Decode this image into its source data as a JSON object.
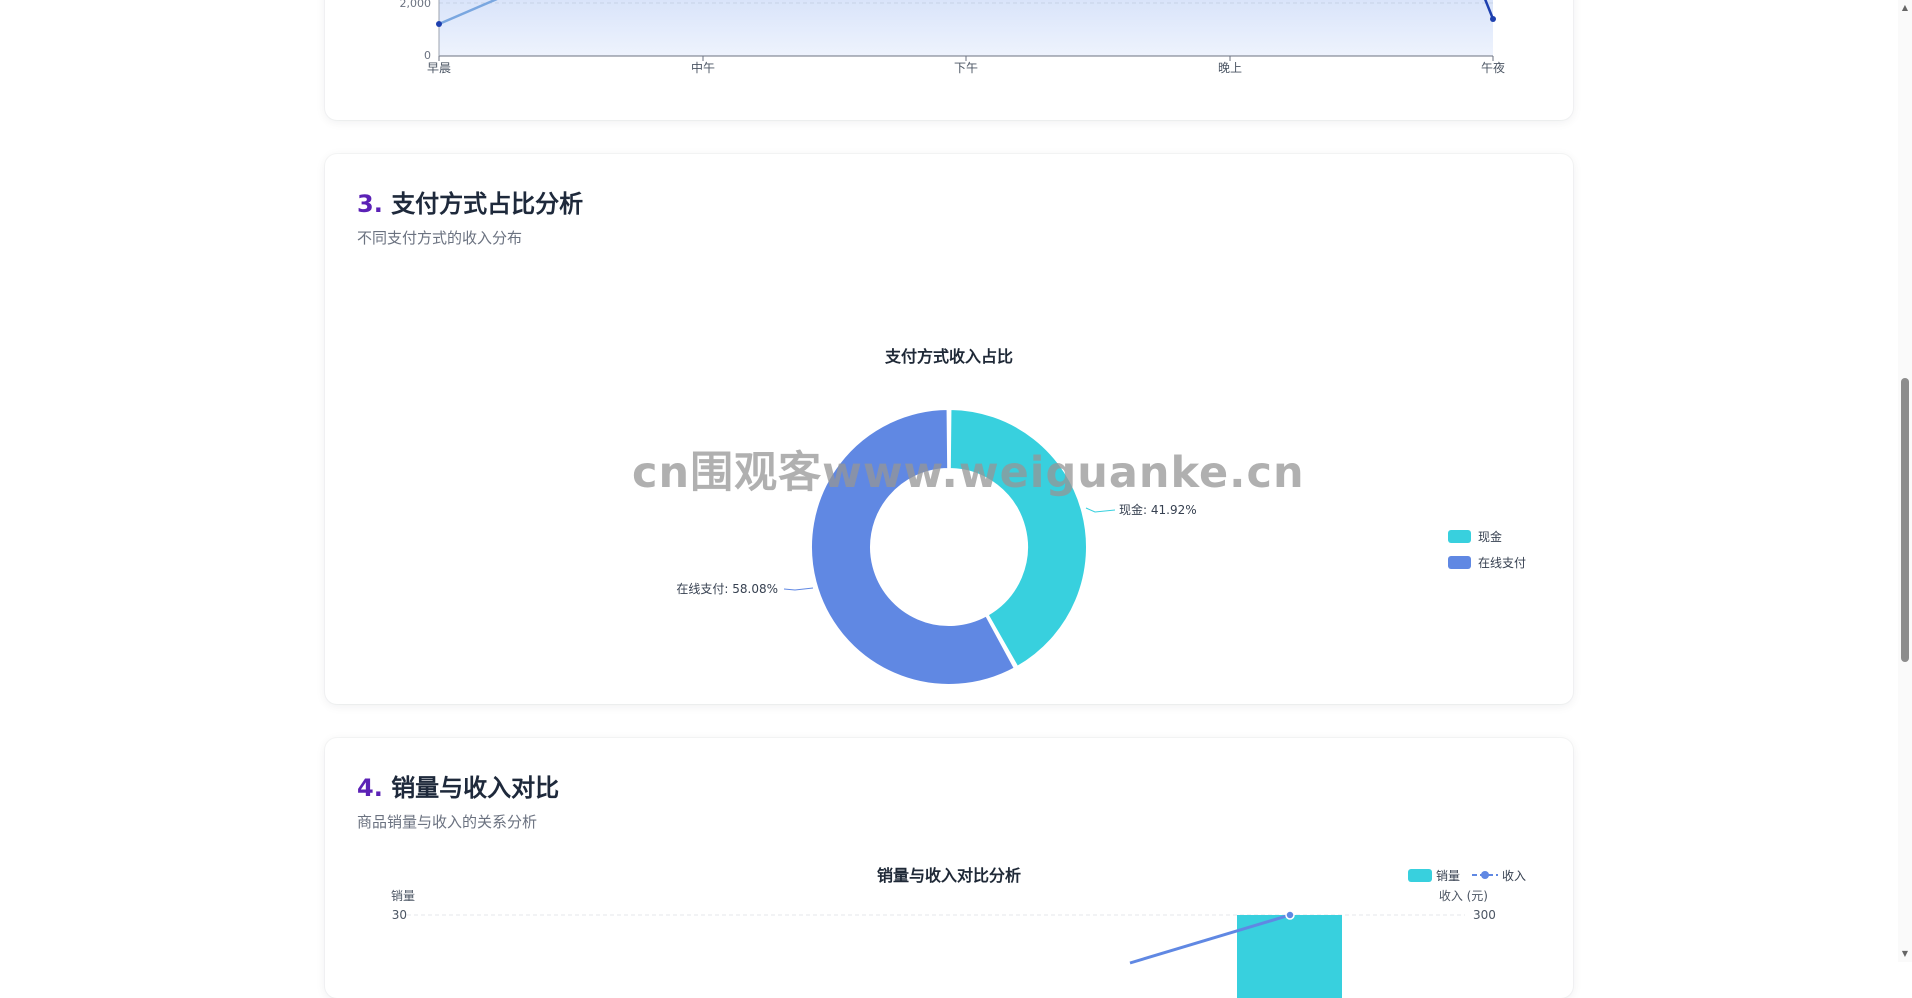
{
  "line_chart": {
    "y_tick_2000": "2,000",
    "y_tick_0": "0",
    "categories": [
      "早晨",
      "中午",
      "下午",
      "晚上",
      "午夜"
    ]
  },
  "section3": {
    "number": "3.",
    "title": "支付方式占比分析",
    "subtitle": "不同支付方式的收入分布"
  },
  "section4": {
    "number": "4.",
    "title": "销量与收入对比",
    "subtitle": "商品销量与收入的关系分析"
  },
  "chart_data": [
    {
      "type": "pie",
      "title": "支付方式收入占比",
      "labels": [
        "现金",
        "在线支付"
      ],
      "values": [
        41.92,
        58.08
      ],
      "slice_labels": [
        "现金: 41.92%",
        "在线支付: 58.08%"
      ],
      "colors": [
        "#38d0de",
        "#6088e3"
      ],
      "legend_position": "right"
    },
    {
      "type": "bar",
      "title": "销量与收入对比分析",
      "series": [
        {
          "name": "销量",
          "type": "bar",
          "color": "#38d0de"
        },
        {
          "name": "收入",
          "type": "line",
          "color": "#6088e3"
        }
      ],
      "y_left_label": "销量",
      "y_right_label": "收入 (元)",
      "y_left_top_tick": "30",
      "y_right_top_tick": "300"
    }
  ],
  "watermark": "cn围观客www.weiguanke.cn",
  "colors": {
    "accent_purple": "#5b21b6",
    "line_dark": "#1e40af",
    "line_light": "#7aa7e0",
    "cyan": "#38d0de",
    "blue": "#6088e3"
  }
}
